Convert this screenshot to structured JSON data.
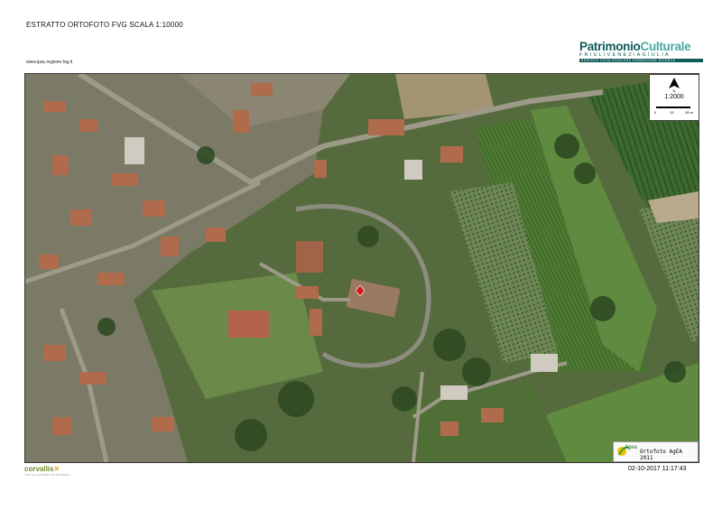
{
  "header": {
    "title": "ESTRATTO ORTOFOTO FVG SCALA 1:10000",
    "url": "www.ipac.regione.fvg.it"
  },
  "logo": {
    "name_part1": "Patrimonio",
    "name_part2": "Culturale",
    "region": "FRIULIVENEZIAGIULIA",
    "tagline": "SERVIZIO CATALOGAZIONE FORMAZIONE RICERCA"
  },
  "scale": {
    "ratio": "1:2000",
    "labels": [
      "0",
      "13",
      "26 m"
    ],
    "north_icon": "north-arrow-icon"
  },
  "attribution": {
    "text": "Ortofoto AgEA 2011",
    "logo_text": "Agea"
  },
  "timestamp": "02-10-2017 11:17:43",
  "footer": {
    "brand_part1": "corvallis",
    "brand_part2": "✕",
    "tagline": "DIGITAL INFORMATION BUSINESS"
  },
  "marker": {
    "icon": "location-diamond-icon",
    "color": "#d0191c"
  }
}
